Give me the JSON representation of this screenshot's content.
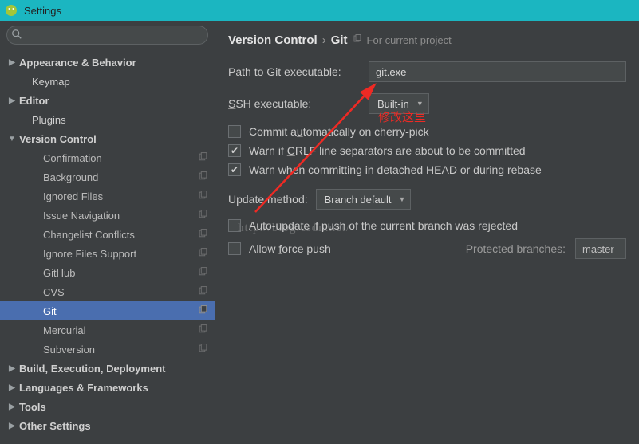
{
  "window": {
    "title": "Settings"
  },
  "sidebar": {
    "search_placeholder": "",
    "items": [
      {
        "label": "Appearance & Behavior",
        "level": 0,
        "arrow": "right"
      },
      {
        "label": "Keymap",
        "level": 1,
        "arrow": "none"
      },
      {
        "label": "Editor",
        "level": 0,
        "arrow": "right"
      },
      {
        "label": "Plugins",
        "level": 1,
        "arrow": "none"
      },
      {
        "label": "Version Control",
        "level": 0,
        "arrow": "down"
      },
      {
        "label": "Confirmation",
        "level": 2,
        "arrow": "none",
        "copy": true
      },
      {
        "label": "Background",
        "level": 2,
        "arrow": "none",
        "copy": true
      },
      {
        "label": "Ignored Files",
        "level": 2,
        "arrow": "none",
        "copy": true
      },
      {
        "label": "Issue Navigation",
        "level": 2,
        "arrow": "none",
        "copy": true
      },
      {
        "label": "Changelist Conflicts",
        "level": 2,
        "arrow": "none",
        "copy": true
      },
      {
        "label": "Ignore Files Support",
        "level": 2,
        "arrow": "none",
        "copy": true
      },
      {
        "label": "GitHub",
        "level": 2,
        "arrow": "none",
        "copy": true
      },
      {
        "label": "CVS",
        "level": 2,
        "arrow": "none",
        "copy": true
      },
      {
        "label": "Git",
        "level": 2,
        "arrow": "none",
        "copy": true,
        "selected": true
      },
      {
        "label": "Mercurial",
        "level": 2,
        "arrow": "none",
        "copy": true
      },
      {
        "label": "Subversion",
        "level": 2,
        "arrow": "none",
        "copy": true
      },
      {
        "label": "Build, Execution, Deployment",
        "level": 0,
        "arrow": "right"
      },
      {
        "label": "Languages & Frameworks",
        "level": 0,
        "arrow": "right"
      },
      {
        "label": "Tools",
        "level": 0,
        "arrow": "right"
      },
      {
        "label": "Other Settings",
        "level": 0,
        "arrow": "right"
      }
    ]
  },
  "breadcrumb": {
    "root": "Version Control",
    "leaf": "Git",
    "hint": "For current project"
  },
  "form": {
    "path_label": "Path to Git executable:",
    "path_value": "git.exe",
    "ssh_label": "SSH executable:",
    "ssh_value": "Built-in",
    "chk1": "Commit automatically on cherry-pick",
    "chk2": "Warn if CRLF line separators are about to be committed",
    "chk3": "Warn when committing in detached HEAD or during rebase",
    "update_label": "Update method:",
    "update_value": "Branch default",
    "chk4": "Auto-update if push of the current branch was rejected",
    "chk5": "Allow force push",
    "protected_label": "Protected branches:",
    "protected_value": "master"
  },
  "annotation": {
    "red_text": "修改这里",
    "watermark": "http://blog.csdn.net/"
  }
}
